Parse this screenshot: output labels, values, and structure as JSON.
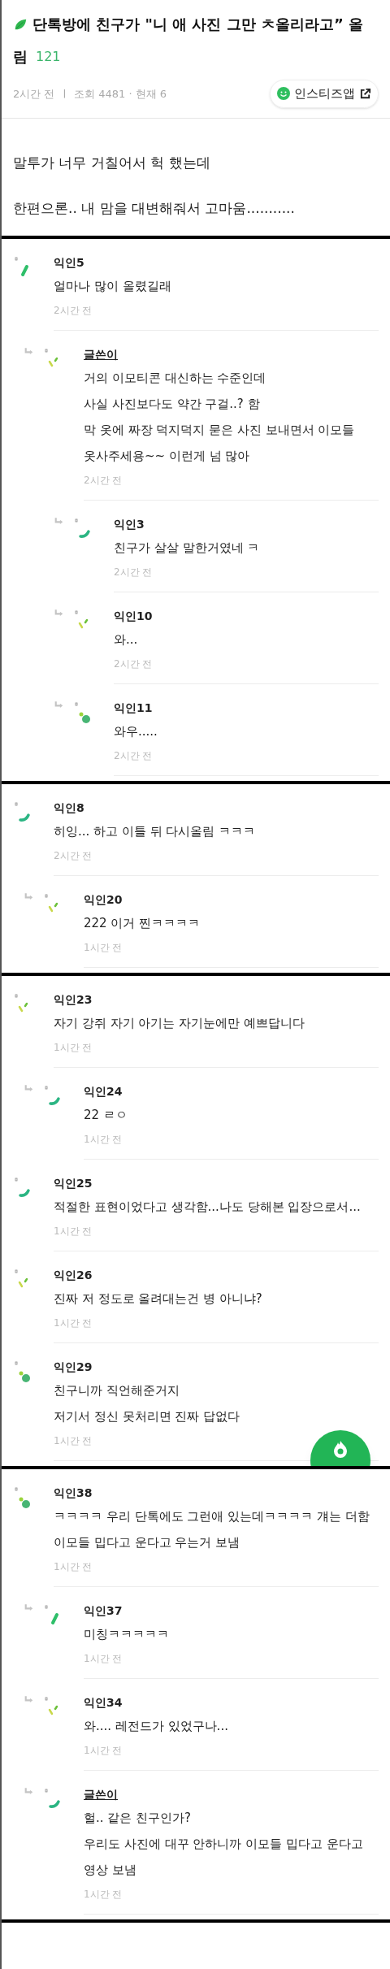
{
  "post": {
    "title_lines": [
      "단톡방에 친구가 \"니 애 사진 그만 ㅊ올리라고” 올",
      "림"
    ],
    "comment_count": "121",
    "time": "2시간 전",
    "separator": "|",
    "views": "조회 4481 · 현재 6",
    "app_button": "인스티즈앱",
    "body": [
      "말투가 너무 거칠어서 헉 했는데",
      "한편으론.. 내 맘을 대변해줘서 고마움..........."
    ]
  },
  "sections": [
    {
      "comments": [
        {
          "author": "익인5",
          "is_author": false,
          "kind": "stick",
          "lines": [
            "얼마나 많이 올렸길래"
          ],
          "time": "2시간 전",
          "children": [
            {
              "author": "글쓴이",
              "is_author": true,
              "kind": "dash",
              "lines": [
                "거의 이모티콘 대신하는 수준인데",
                "사실 사진보다도 약간 구걸..? 함",
                "막 옷에 짜장 덕지덕지 묻은 사진 보내면서 이모들",
                "옷사주세용~~ 이런게 넘 많아"
              ],
              "time": "2시간 전",
              "children": [
                {
                  "author": "익인3",
                  "is_author": false,
                  "kind": "arc",
                  "lines": [
                    "친구가 살살 말한거였네 ㅋ"
                  ],
                  "time": "2시간 전"
                },
                {
                  "author": "익인10",
                  "is_author": false,
                  "kind": "dash",
                  "lines": [
                    "와..."
                  ],
                  "time": "2시간 전"
                },
                {
                  "author": "익인11",
                  "is_author": false,
                  "kind": "dots",
                  "lines": [
                    "와우....."
                  ],
                  "time": "2시간 전"
                }
              ]
            }
          ]
        }
      ]
    },
    {
      "comments": [
        {
          "author": "익인8",
          "is_author": false,
          "kind": "arc",
          "lines": [
            "히잉... 하고 이틀 뒤 다시올림 ㅋㅋㅋ"
          ],
          "time": "2시간 전",
          "children": [
            {
              "author": "익인20",
              "is_author": false,
              "kind": "dash",
              "lines": [
                "222 이거 찐ㅋㅋㅋㅋ"
              ],
              "time": "1시간 전"
            }
          ]
        }
      ]
    },
    {
      "floating_button": true,
      "comments": [
        {
          "author": "익인23",
          "is_author": false,
          "kind": "dash",
          "lines": [
            "자기 강쥐 자기 아기는 자기눈에만 예쁘답니다"
          ],
          "time": "1시간 전",
          "children": [
            {
              "author": "익인24",
              "is_author": false,
              "kind": "arc",
              "lines": [
                "22 ㄹㅇ"
              ],
              "time": "1시간 전"
            }
          ]
        },
        {
          "author": "익인25",
          "is_author": false,
          "kind": "arc",
          "lines": [
            "적절한 표현이었다고 생각함...나도 당해본 입장으로서..."
          ],
          "time": "1시간 전"
        },
        {
          "author": "익인26",
          "is_author": false,
          "kind": "dash",
          "lines": [
            "진짜 저 정도로 올려대는건 병 아니냐?"
          ],
          "time": "1시간 전"
        },
        {
          "author": "익인29",
          "is_author": false,
          "kind": "dots",
          "lines": [
            "친구니까 직언해준거지",
            "저기서 정신 못처리면 진짜 답없다"
          ],
          "time": "1시간 전"
        }
      ]
    },
    {
      "comments": [
        {
          "author": "익인38",
          "is_author": false,
          "kind": "dots",
          "lines": [
            "ㅋㅋㅋㅋ 우리 단톡에도 그런애 있는데ㅋㅋㅋㅋ 걔는 더함 이모들 밉다고 운다고 우는거 보냄"
          ],
          "time": "1시간 전",
          "children": [
            {
              "author": "익인37",
              "is_author": false,
              "kind": "stick",
              "lines": [
                "미칭ㅋㅋㅋㅋㅋ"
              ],
              "time": "1시간 전"
            },
            {
              "author": "익인34",
              "is_author": false,
              "kind": "dash",
              "lines": [
                "와.... 레전드가 있었구나..."
              ],
              "time": "1시간 전"
            },
            {
              "author": "글쓴이",
              "is_author": true,
              "kind": "arc",
              "lines": [
                "헐.. 같은 친구인가?",
                "우리도 사진에 대꾸 안하니까 이모들 밉다고 운다고 영상 보냄"
              ],
              "time": "1시간 전"
            }
          ]
        }
      ]
    }
  ]
}
